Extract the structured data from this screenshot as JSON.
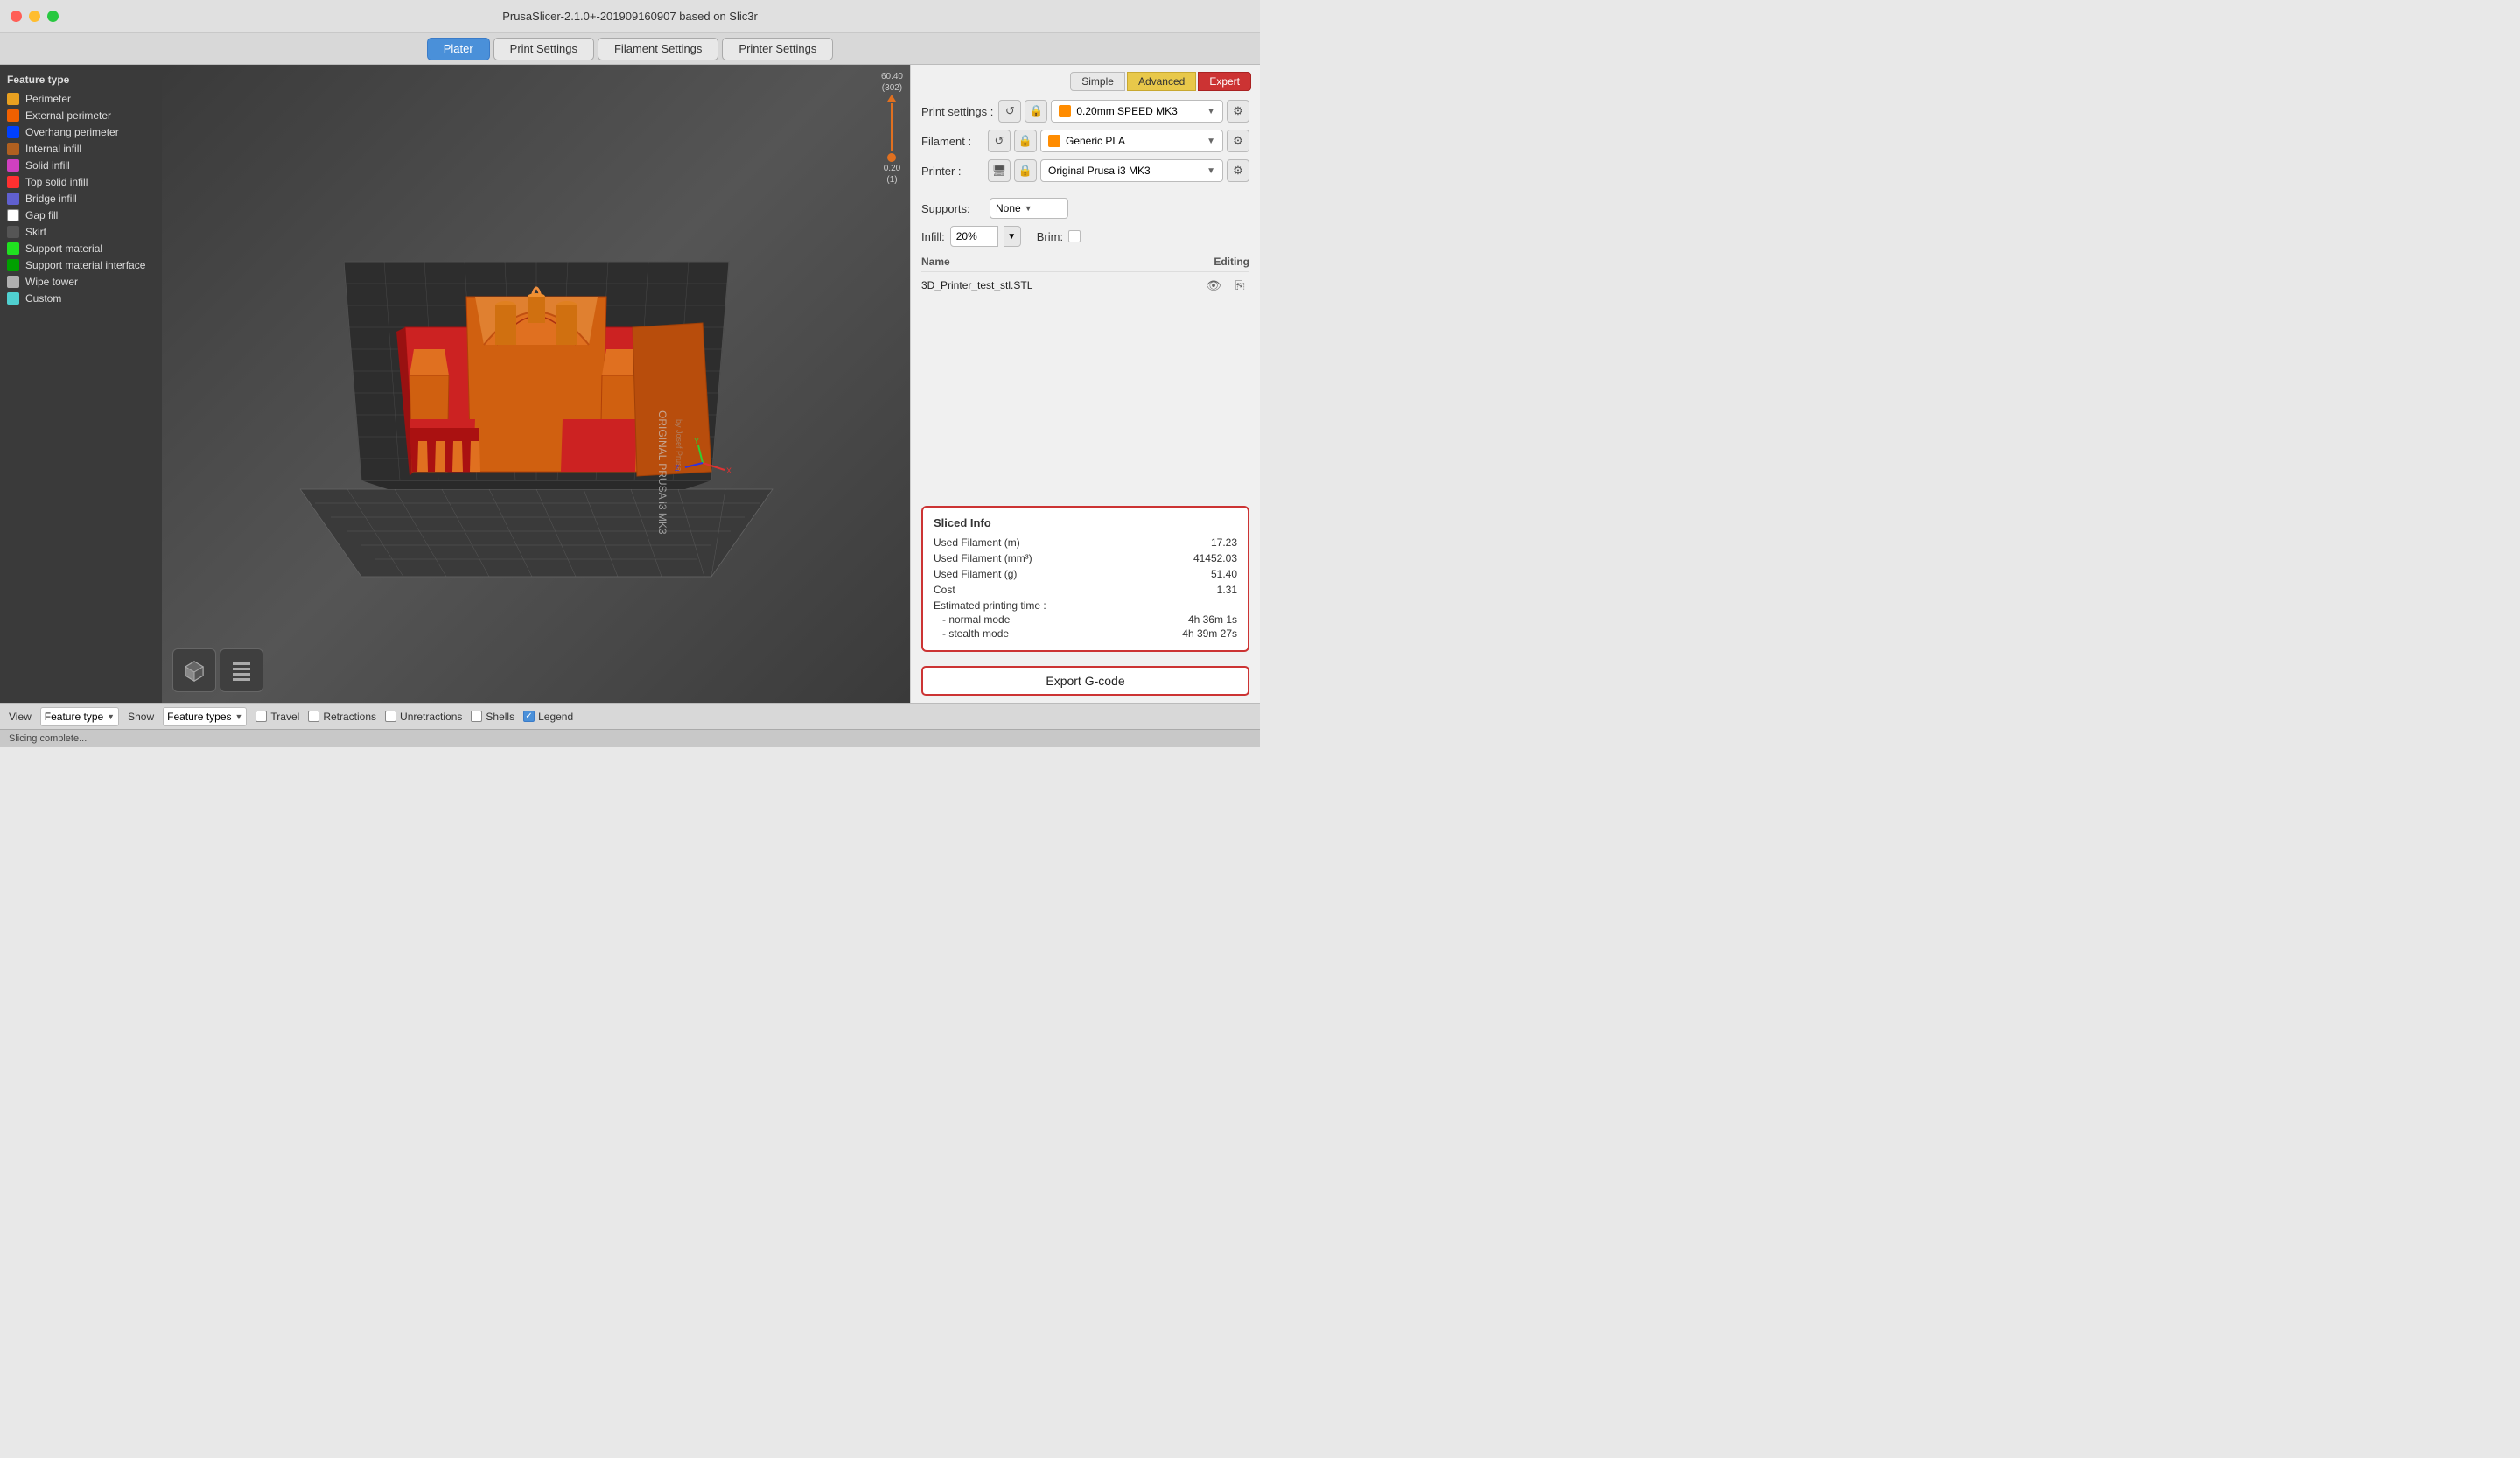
{
  "app": {
    "title": "PrusaSlicer-2.1.0+-201909160907 based on Slic3r",
    "traffic": {
      "close": "close",
      "minimize": "minimize",
      "maximize": "maximize"
    }
  },
  "tabs": [
    {
      "id": "plater",
      "label": "Plater",
      "active": true
    },
    {
      "id": "print-settings",
      "label": "Print Settings",
      "active": false
    },
    {
      "id": "filament-settings",
      "label": "Filament Settings",
      "active": false
    },
    {
      "id": "printer-settings",
      "label": "Printer Settings",
      "active": false
    }
  ],
  "legend": {
    "title": "Feature type",
    "items": [
      {
        "id": "perimeter",
        "label": "Perimeter",
        "color": "#e8a020"
      },
      {
        "id": "external-perimeter",
        "label": "External perimeter",
        "color": "#f06000"
      },
      {
        "id": "overhang-perimeter",
        "label": "Overhang perimeter",
        "color": "#0040ff"
      },
      {
        "id": "internal-infill",
        "label": "Internal infill",
        "color": "#b06020"
      },
      {
        "id": "solid-infill",
        "label": "Solid infill",
        "color": "#d040c0"
      },
      {
        "id": "top-solid-infill",
        "label": "Top solid infill",
        "color": "#ff3030"
      },
      {
        "id": "bridge-infill",
        "label": "Bridge infill",
        "color": "#6060d0"
      },
      {
        "id": "gap-fill",
        "label": "Gap fill",
        "color": "#ffffff"
      },
      {
        "id": "skirt",
        "label": "Skirt",
        "color": "#444444"
      },
      {
        "id": "support-material",
        "label": "Support material",
        "color": "#20e020"
      },
      {
        "id": "support-material-interface",
        "label": "Support material interface",
        "color": "#00a000"
      },
      {
        "id": "wipe-tower",
        "label": "Wipe tower",
        "color": "#b0b0b0"
      },
      {
        "id": "custom",
        "label": "Custom",
        "color": "#50d0d0"
      }
    ]
  },
  "scale": {
    "top": "60.40",
    "bottom": "(302)",
    "bottom_val": "0.20",
    "bottom_num": "(1)"
  },
  "right_panel": {
    "modes": [
      {
        "id": "simple",
        "label": "Simple",
        "active": false
      },
      {
        "id": "advanced",
        "label": "Advanced",
        "active": false
      },
      {
        "id": "expert",
        "label": "Expert",
        "active": true
      }
    ],
    "print_settings": {
      "label": "Print settings :",
      "value": "0.20mm SPEED MK3",
      "icon_color": "#ff8c00"
    },
    "filament": {
      "label": "Filament :",
      "value": "Generic PLA",
      "icon_color": "#ff8c00"
    },
    "printer": {
      "label": "Printer :",
      "value": "Original Prusa i3 MK3"
    },
    "supports": {
      "label": "Supports:",
      "value": "None"
    },
    "infill": {
      "label": "Infill:",
      "value": "20%"
    },
    "brim": {
      "label": "Brim:",
      "checked": false
    },
    "name_column": "Name",
    "editing_column": "Editing",
    "file": {
      "name": "3D_Printer_test_stl.STL"
    }
  },
  "sliced_info": {
    "title": "Sliced Info",
    "rows": [
      {
        "label": "Used Filament (m)",
        "value": "17.23"
      },
      {
        "label": "Used Filament (mm³)",
        "value": "41452.03"
      },
      {
        "label": "Used Filament (g)",
        "value": "51.40"
      },
      {
        "label": "Cost",
        "value": "1.31"
      }
    ],
    "print_time": {
      "label": "Estimated printing time :",
      "modes": [
        {
          "label": "- normal mode",
          "value": "4h 36m 1s"
        },
        {
          "label": "- stealth mode",
          "value": "4h 39m 27s"
        }
      ]
    }
  },
  "export": {
    "label": "Export G-code"
  },
  "bottom_toolbar": {
    "view_label": "View",
    "view_value": "Feature type",
    "show_label": "Show",
    "show_value": "Feature types",
    "checkboxes": [
      {
        "id": "travel",
        "label": "Travel",
        "checked": false
      },
      {
        "id": "retractions",
        "label": "Retractions",
        "checked": false
      },
      {
        "id": "unretractions",
        "label": "Unretractions",
        "checked": false
      },
      {
        "id": "shells",
        "label": "Shells",
        "checked": false
      },
      {
        "id": "legend",
        "label": "Legend",
        "checked": true
      }
    ]
  },
  "status_bar": {
    "text": "Slicing complete..."
  }
}
